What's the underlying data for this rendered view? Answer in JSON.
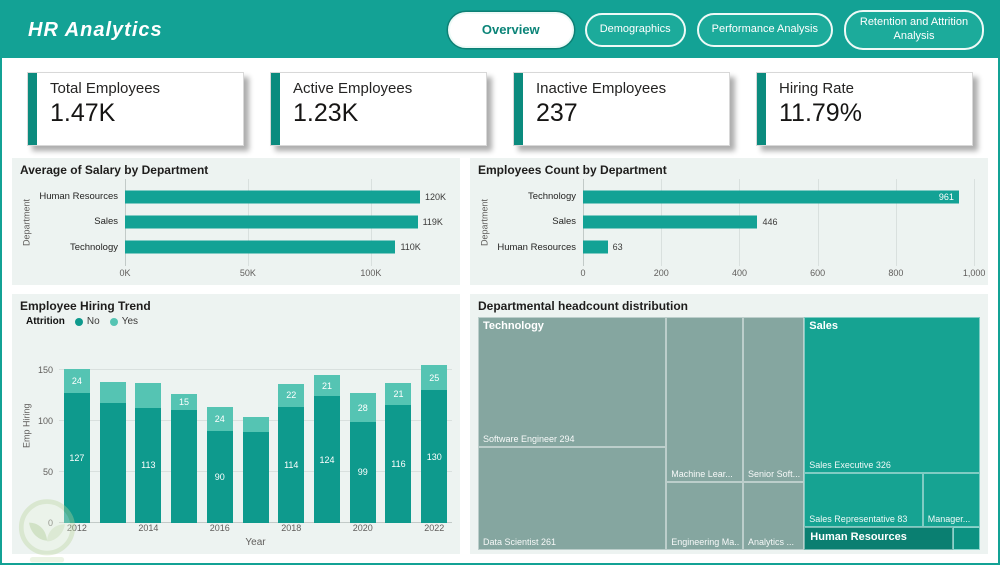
{
  "theme": {
    "teal": "#13a295",
    "teal_dark": "#0b8b7e",
    "tab_bg": "#1cab9b",
    "tab_active_text": "#0b8478",
    "panel_bg": "#edf3f1"
  },
  "header": {
    "title": "HR Analytics",
    "tabs": [
      {
        "label": "Overview",
        "active": true
      },
      {
        "label": "Demographics",
        "active": false
      },
      {
        "label": "Performance Analysis",
        "active": false
      },
      {
        "label": "Retention and Attrition Analysis",
        "active": false
      }
    ]
  },
  "kpis": [
    {
      "label": "Total Employees",
      "value": "1.47K"
    },
    {
      "label": "Active Employees",
      "value": "1.23K"
    },
    {
      "label": "Inactive Employees",
      "value": "237"
    },
    {
      "label": "Hiring Rate",
      "value": "11.79%"
    }
  ],
  "chart_data": [
    {
      "type": "bar",
      "orientation": "horizontal",
      "title": "Average of Salary by Department",
      "ylabel": "Department",
      "color": "#13a295",
      "categories": [
        "Human Resources",
        "Sales",
        "Technology"
      ],
      "values": [
        120,
        119,
        110
      ],
      "value_labels": [
        "120K",
        "119K",
        "110K"
      ],
      "label_inside": [
        false,
        false,
        false
      ],
      "xmax": 133,
      "xticks": [
        {
          "value": 0,
          "label": "0K"
        },
        {
          "value": 50,
          "label": "50K"
        },
        {
          "value": 100,
          "label": "100K"
        }
      ]
    },
    {
      "type": "bar",
      "orientation": "horizontal",
      "title": "Employees Count by Department",
      "ylabel": "Department",
      "color": "#13a295",
      "categories": [
        "Technology",
        "Sales",
        "Human Resources"
      ],
      "values": [
        961,
        446,
        63
      ],
      "value_labels": [
        "961",
        "446",
        "63"
      ],
      "label_inside": [
        true,
        false,
        false
      ],
      "xmax": 1015,
      "xticks": [
        {
          "value": 0,
          "label": "0"
        },
        {
          "value": 200,
          "label": "200"
        },
        {
          "value": 400,
          "label": "400"
        },
        {
          "value": 600,
          "label": "600"
        },
        {
          "value": 800,
          "label": "800"
        },
        {
          "value": 1000,
          "label": "1,000"
        }
      ]
    },
    {
      "type": "stacked-bar",
      "title": "Employee Hiring Trend",
      "legend": {
        "title": "Attrition",
        "items": [
          "No",
          "Yes"
        ]
      },
      "xlabel": "Year",
      "ylabel": "Emp Hiring",
      "ymax": 190,
      "yticks": [
        0,
        50,
        100,
        150
      ],
      "x": [
        2012,
        2013,
        2014,
        2015,
        2016,
        2017,
        2018,
        2019,
        2020,
        2021,
        2022
      ],
      "xtick_labels": [
        "2012",
        "",
        "2014",
        "",
        "2016",
        "",
        "2018",
        "",
        "2020",
        "",
        "2022"
      ],
      "series": [
        {
          "name": "No",
          "color": "#0e9a8d",
          "values": [
            127,
            118,
            113,
            111,
            90,
            89,
            114,
            124,
            99,
            116,
            130
          ],
          "labels": [
            "127",
            "",
            "113",
            "",
            "90",
            "",
            "114",
            "124",
            "99",
            "116",
            "130"
          ]
        },
        {
          "name": "Yes",
          "color": "#55c4b3",
          "values": [
            24,
            20,
            24,
            15,
            24,
            15,
            22,
            21,
            28,
            21,
            25
          ],
          "labels": [
            "24",
            "",
            "",
            "15",
            "24",
            "",
            "22",
            "21",
            "28",
            "21",
            "25"
          ]
        }
      ]
    },
    {
      "type": "treemap",
      "title": "Departmental headcount distribution",
      "groups": [
        {
          "name": "Technology",
          "color": "#85a6a0",
          "items": [
            {
              "label": "Software Engineer 294"
            },
            {
              "label": "Data Scientist 261"
            },
            {
              "label": "Machine Lear..."
            },
            {
              "label": "Senior Soft..."
            },
            {
              "label": "Engineering Ma..."
            },
            {
              "label": "Analytics ..."
            }
          ]
        },
        {
          "name": "Sales",
          "color": "#16a392",
          "items": [
            {
              "label": "Sales Executive 326"
            },
            {
              "label": "Sales Representative 83"
            },
            {
              "label": "Manager..."
            }
          ]
        },
        {
          "name": "Human Resources",
          "color": "#0a7f71",
          "items": []
        }
      ]
    }
  ]
}
